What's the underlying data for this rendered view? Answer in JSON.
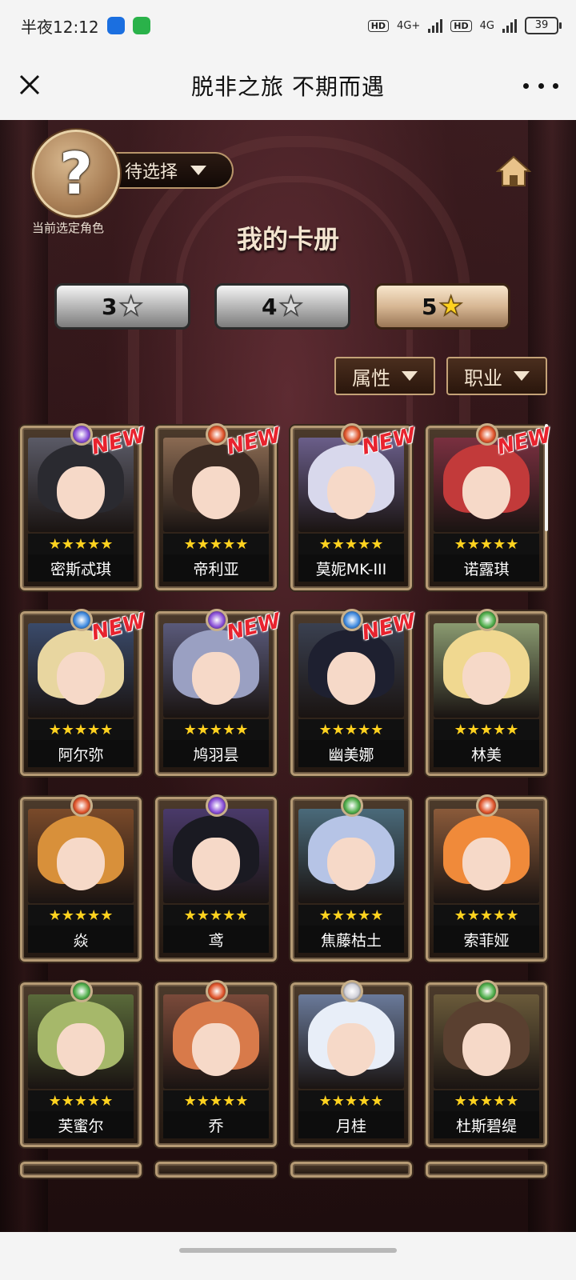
{
  "status_bar": {
    "time": "半夜12:12",
    "network_1": "4G+",
    "network_2": "4G",
    "hd": "HD",
    "battery": "39"
  },
  "title_bar": {
    "title": "脱非之旅 不期而遇"
  },
  "game": {
    "avatar_symbol": "?",
    "selector_label": "待选择",
    "avatar_label": "当前选定角色",
    "heading": "我的卡册",
    "star_tabs": [
      {
        "num": "3",
        "active": false
      },
      {
        "num": "4",
        "active": false
      },
      {
        "num": "5",
        "active": true
      }
    ],
    "filters": {
      "attribute": "属性",
      "job": "职业"
    },
    "new_label": "NEW",
    "stars": "★★★★★",
    "cards": [
      {
        "name": "密斯忒琪",
        "new": true,
        "gem": "#8a4fd8",
        "hair": "#2a2a30",
        "bg": "#5a5a66"
      },
      {
        "name": "帝利亚",
        "new": true,
        "gem": "#e0542a",
        "hair": "#3b2a22",
        "bg": "#8a6a52"
      },
      {
        "name": "莫妮MK-III",
        "new": true,
        "gem": "#e0542a",
        "hair": "#d8d8ec",
        "bg": "#6a5e8a"
      },
      {
        "name": "诺露琪",
        "new": true,
        "gem": "#e0542a",
        "hair": "#c23a3a",
        "bg": "#7a3040"
      },
      {
        "name": "阿尔弥",
        "new": true,
        "gem": "#3f8ae0",
        "hair": "#e8d6a0",
        "bg": "#3a4a6a"
      },
      {
        "name": "鸠羽昙",
        "new": true,
        "gem": "#8a4fd8",
        "hair": "#9aa0c2",
        "bg": "#5a5a7a"
      },
      {
        "name": "幽美娜",
        "new": true,
        "gem": "#3f8ae0",
        "hair": "#1e2030",
        "bg": "#3a4050"
      },
      {
        "name": "林美",
        "new": false,
        "gem": "#4fae4a",
        "hair": "#f0d890",
        "bg": "#8a9a70"
      },
      {
        "name": "焱",
        "new": false,
        "gem": "#e0542a",
        "hair": "#d8903a",
        "bg": "#7a4a2a"
      },
      {
        "name": "鸢",
        "new": false,
        "gem": "#8a4fd8",
        "hair": "#1a1a22",
        "bg": "#4a3a6a"
      },
      {
        "name": "焦藤枯土",
        "new": false,
        "gem": "#4fae4a",
        "hair": "#b6c4e6",
        "bg": "#4a6a7a"
      },
      {
        "name": "索菲娅",
        "new": false,
        "gem": "#e0542a",
        "hair": "#f08a3a",
        "bg": "#8a5a3a"
      },
      {
        "name": "芙蜜尔",
        "new": false,
        "gem": "#4fae4a",
        "hair": "#a6b86a",
        "bg": "#5a6a3a"
      },
      {
        "name": "乔",
        "new": false,
        "gem": "#e0542a",
        "hair": "#d87a4a",
        "bg": "#7a4a3a"
      },
      {
        "name": "月桂",
        "new": false,
        "gem": "#d0d0d8",
        "hair": "#e8eef8",
        "bg": "#6a7a9a"
      },
      {
        "name": "杜斯碧缇",
        "new": false,
        "gem": "#4fae4a",
        "hair": "#5a4030",
        "bg": "#6a5a3a"
      }
    ]
  }
}
